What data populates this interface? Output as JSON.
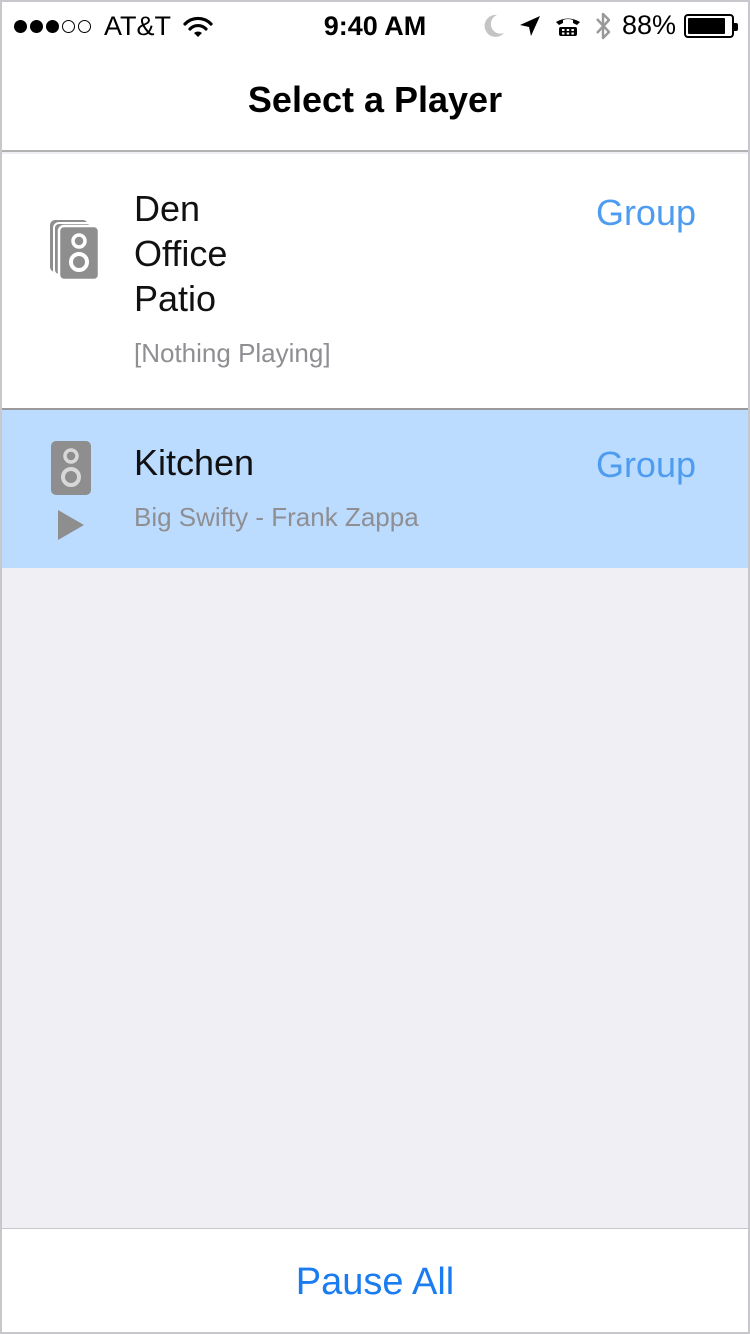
{
  "status_bar": {
    "signal_full": 3,
    "signal_total": 5,
    "carrier": "AT&T",
    "time": "9:40 AM",
    "battery_percent": "88%",
    "battery_level": 0.88,
    "icons": [
      "wifi-icon",
      "moon-icon",
      "location-arrow-icon",
      "tty-icon",
      "bluetooth-icon",
      "battery-icon"
    ]
  },
  "nav": {
    "title": "Select a Player"
  },
  "players": [
    {
      "rooms": [
        "Den",
        "Office",
        "Patio"
      ],
      "now_playing": "[Nothing Playing]",
      "group_label": "Group",
      "icon": "speaker-group-icon",
      "playing": false,
      "selected": false
    },
    {
      "rooms": [
        "Kitchen"
      ],
      "now_playing": "Big Swifty - Frank Zappa",
      "group_label": "Group",
      "icon": "speaker-icon",
      "playing": true,
      "selected": true
    }
  ],
  "bottom": {
    "pause_all_label": "Pause All"
  },
  "colors": {
    "accent": "#1a7cf0",
    "group_link": "#4d9cf0",
    "selected_row": "#bbdcff",
    "background": "#efeff4",
    "secondary_text": "#8e8e93",
    "icon_gray": "#8e8e8e"
  }
}
